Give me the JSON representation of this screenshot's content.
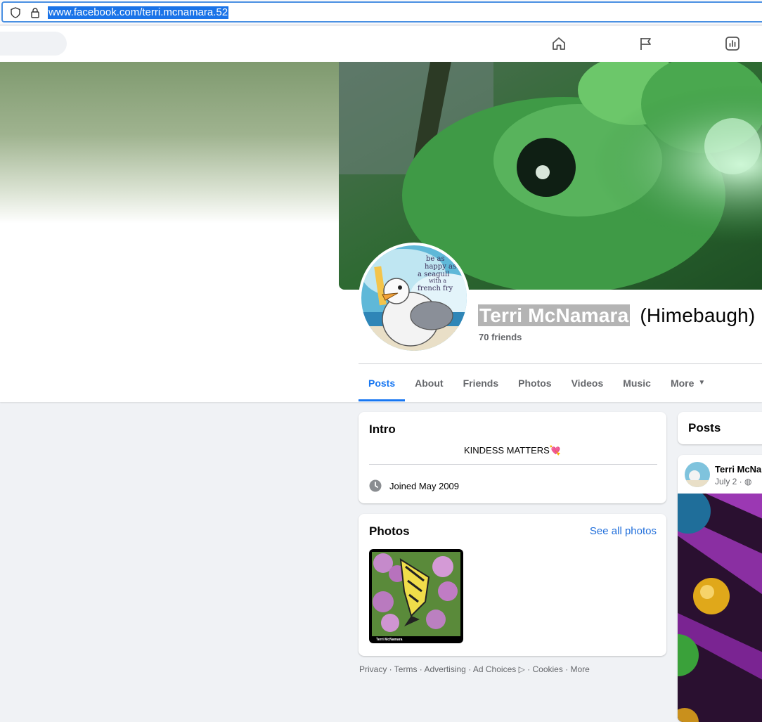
{
  "browser": {
    "url": "www.facebook.com/terri.mcnamara.52"
  },
  "nav": {
    "icons": [
      "home-icon",
      "flag-icon",
      "chart-icon"
    ]
  },
  "profile": {
    "name": "Terri McNamara",
    "alternate_name": "(Himebaugh)",
    "friends": "70 friends",
    "avatar_text": [
      "be as",
      "happy as",
      "a seagull",
      "with a",
      "french fry"
    ]
  },
  "tabs": [
    {
      "label": "Posts",
      "active": true
    },
    {
      "label": "About"
    },
    {
      "label": "Friends"
    },
    {
      "label": "Photos"
    },
    {
      "label": "Videos"
    },
    {
      "label": "Music"
    },
    {
      "label": "More"
    }
  ],
  "intro": {
    "title": "Intro",
    "bio": "KINDESS MATTERS💘",
    "joined": "Joined May 2009"
  },
  "photos": {
    "title": "Photos",
    "see_all": "See all photos",
    "thumb_caption": "Terri McNamara"
  },
  "footer": {
    "links": [
      "Privacy",
      "Terms",
      "Advertising",
      "Ad Choices",
      "Cookies",
      "More"
    ]
  },
  "posts": {
    "title": "Posts",
    "author": "Terri McNa",
    "date": "July 2 · "
  },
  "colors": {
    "accent": "#1877f2",
    "link": "#216fdb",
    "muted": "#65676b"
  }
}
